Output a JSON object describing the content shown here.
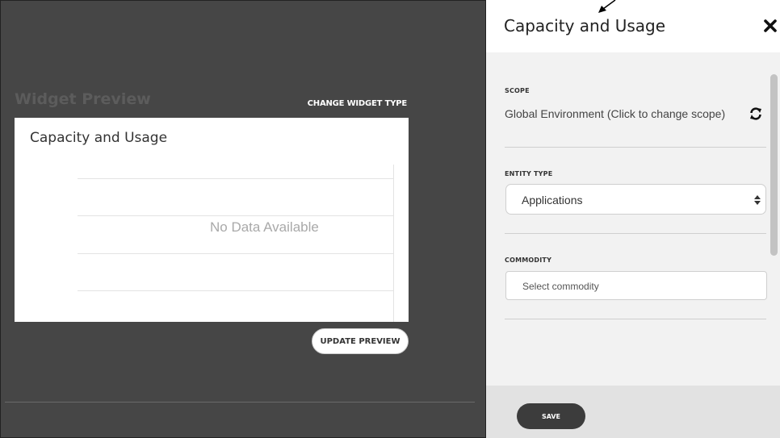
{
  "preview": {
    "section_title": "Widget Preview",
    "change_widget_type_label": "CHANGE WIDGET TYPE",
    "widget_title": "Capacity and Usage",
    "empty_message": "No Data Available",
    "update_preview_label": "UPDATE PREVIEW"
  },
  "panel": {
    "title": "Capacity and Usage",
    "close_icon": "close-icon",
    "scope": {
      "label": "SCOPE",
      "value": "Global Environment (Click to change scope)",
      "icon": "refresh-icon"
    },
    "entity_type": {
      "label": "ENTITY TYPE",
      "value": "Applications",
      "icon": "sort-icon"
    },
    "commodity": {
      "label": "COMMODITY",
      "placeholder": "Select commodity"
    },
    "save_label": "SAVE"
  },
  "colors": {
    "preview_bg": "#464646",
    "panel_bg": "#f2f2f2",
    "footer_bg": "#e2e2e2",
    "save_button": "#3c3c3c"
  }
}
